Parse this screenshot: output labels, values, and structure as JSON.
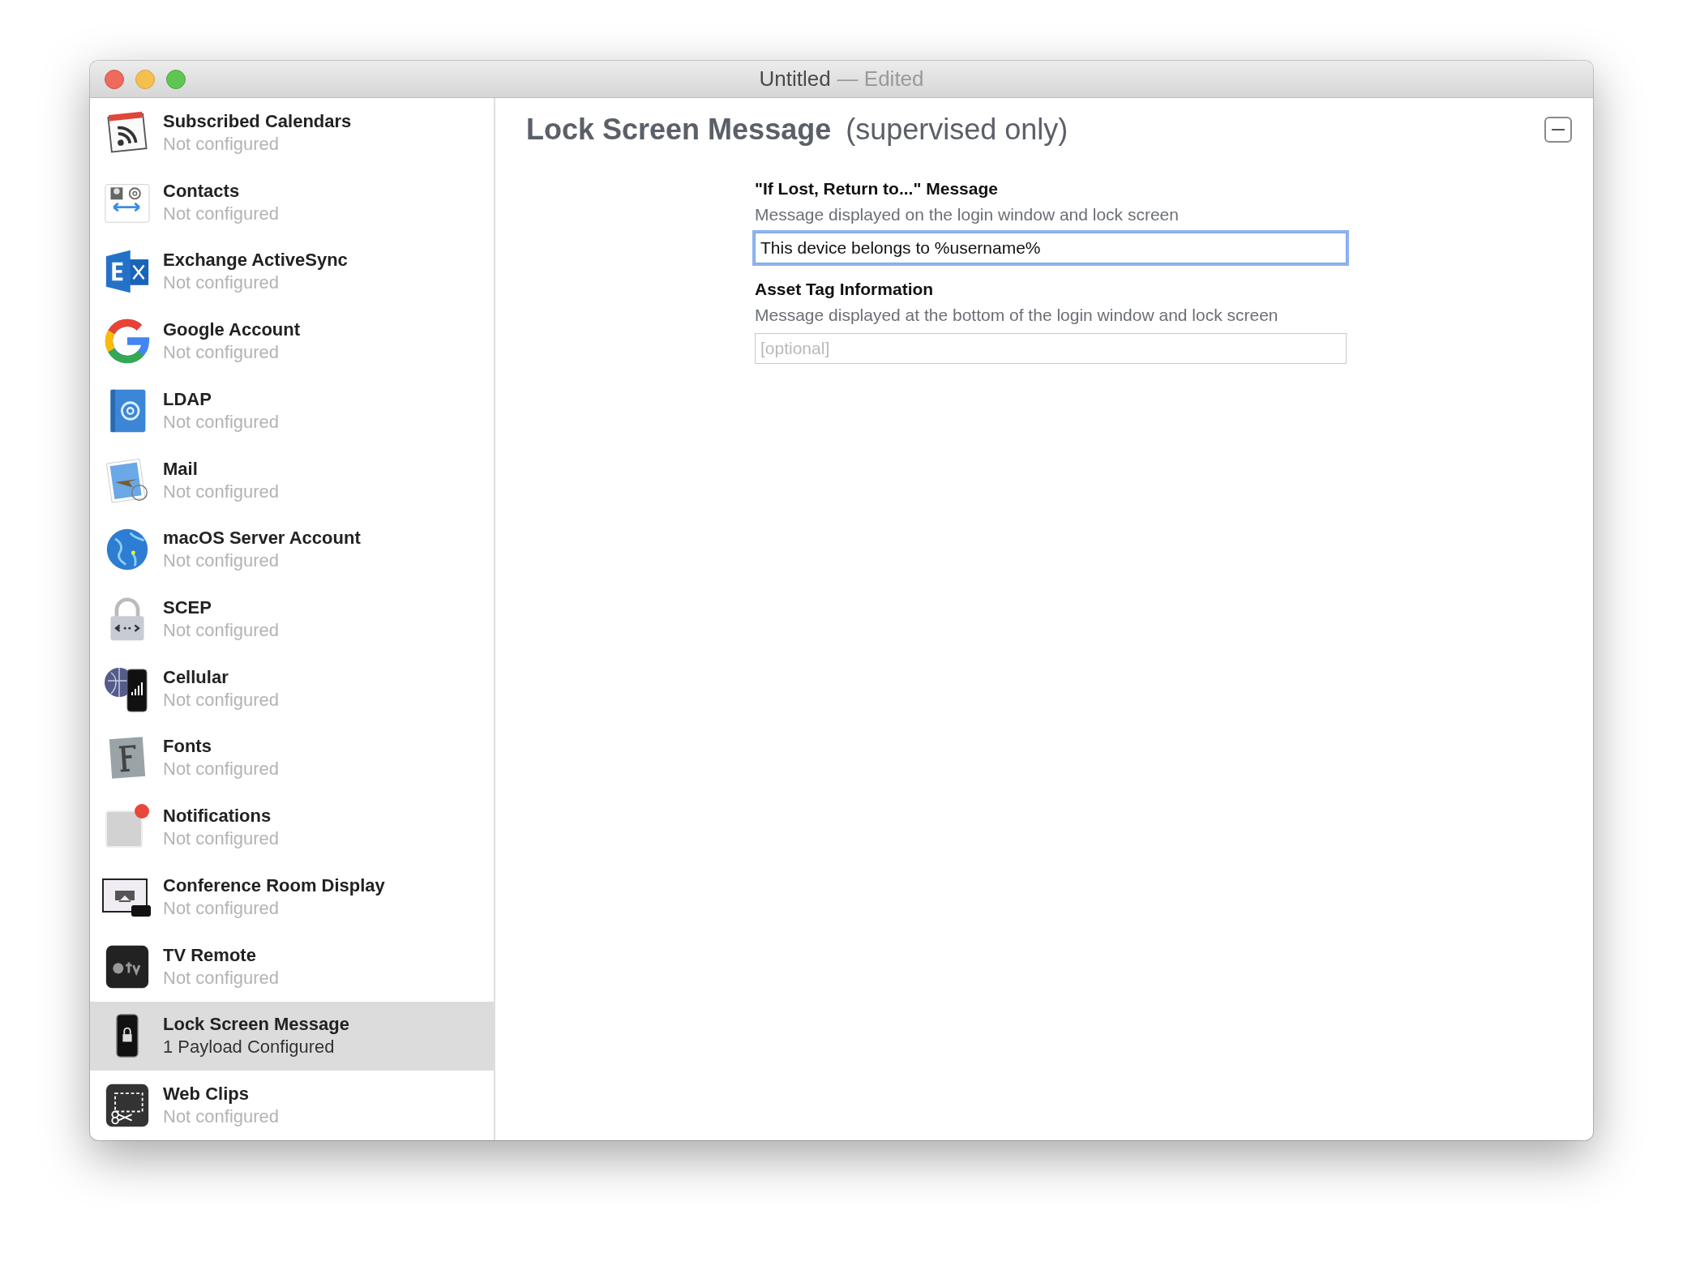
{
  "window": {
    "title": "Untitled",
    "status": "— Edited"
  },
  "sidebar": {
    "items": [
      {
        "kind": "rss",
        "title": "Subscribed Calendars",
        "subtitle": "Not configured",
        "selected": false
      },
      {
        "kind": "contacts",
        "title": "Contacts",
        "subtitle": "Not configured",
        "selected": false
      },
      {
        "kind": "exchange",
        "title": "Exchange ActiveSync",
        "subtitle": "Not configured",
        "selected": false
      },
      {
        "kind": "google",
        "title": "Google Account",
        "subtitle": "Not configured",
        "selected": false
      },
      {
        "kind": "ldap",
        "title": "LDAP",
        "subtitle": "Not configured",
        "selected": false
      },
      {
        "kind": "mail",
        "title": "Mail",
        "subtitle": "Not configured",
        "selected": false
      },
      {
        "kind": "globe",
        "title": "macOS Server Account",
        "subtitle": "Not configured",
        "selected": false
      },
      {
        "kind": "lock",
        "title": "SCEP",
        "subtitle": "Not configured",
        "selected": false
      },
      {
        "kind": "cellular",
        "title": "Cellular",
        "subtitle": "Not configured",
        "selected": false
      },
      {
        "kind": "fonts",
        "title": "Fonts",
        "subtitle": "Not configured",
        "selected": false
      },
      {
        "kind": "notification",
        "title": "Notifications",
        "subtitle": "Not configured",
        "selected": false
      },
      {
        "kind": "display",
        "title": "Conference Room Display",
        "subtitle": "Not configured",
        "selected": false
      },
      {
        "kind": "tv",
        "title": "TV Remote",
        "subtitle": "Not configured",
        "selected": false
      },
      {
        "kind": "phonelock",
        "title": "Lock Screen Message",
        "subtitle": "1 Payload Configured",
        "selected": true
      },
      {
        "kind": "scissors",
        "title": "Web Clips",
        "subtitle": "Not configured",
        "selected": false
      }
    ]
  },
  "payload": {
    "title": "Lock Screen Message",
    "qualifier": "(supervised only)",
    "fields": [
      {
        "label": "\"If Lost, Return to...\" Message",
        "description": "Message displayed on the login window and lock screen",
        "value": "This device belongs to %username%",
        "focused": true
      },
      {
        "label": "Asset Tag Information",
        "description": "Message displayed at the bottom of the login window and lock screen",
        "placeholder": "[optional]",
        "focused": false
      }
    ]
  }
}
